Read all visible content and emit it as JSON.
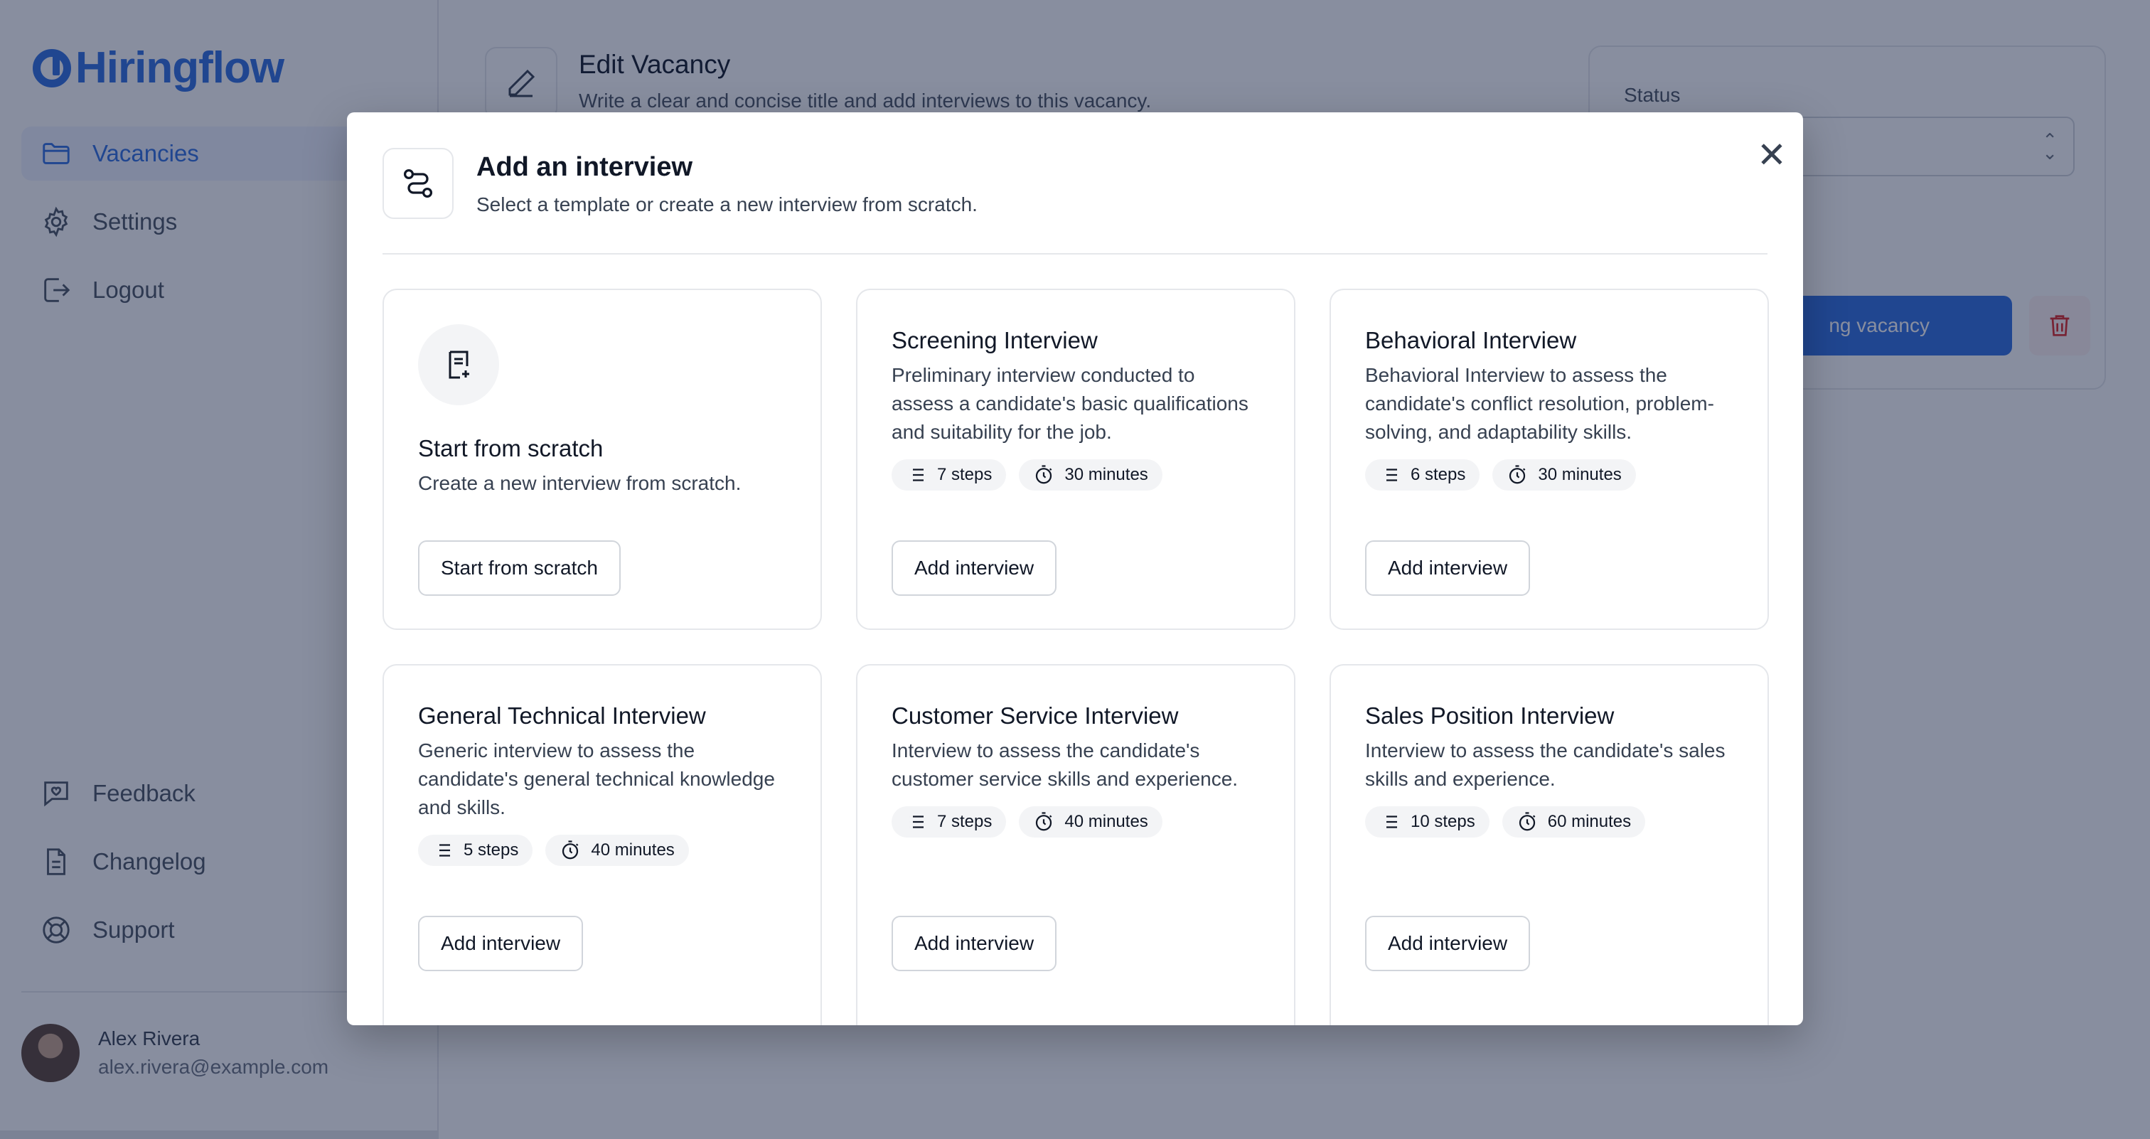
{
  "app": {
    "name": "Hiringflow"
  },
  "sidebar": {
    "items": [
      {
        "label": "Vacancies",
        "icon": "folder-icon",
        "active": true
      },
      {
        "label": "Settings",
        "icon": "gear-icon"
      },
      {
        "label": "Logout",
        "icon": "logout-icon"
      }
    ],
    "bottom_items": [
      {
        "label": "Feedback",
        "icon": "feedback-icon"
      },
      {
        "label": "Changelog",
        "icon": "document-icon"
      },
      {
        "label": "Support",
        "icon": "lifebuoy-icon"
      }
    ],
    "user": {
      "name": "Alex Rivera",
      "email": "alex.rivera@example.com"
    }
  },
  "page": {
    "title": "Edit Vacancy",
    "subtitle": "Write a clear and concise title and add interviews to this vacancy.",
    "status_label": "Status",
    "primary_button_partial": "ng vacancy"
  },
  "modal": {
    "title": "Add an interview",
    "subtitle": "Select a template or create a new interview from scratch.",
    "close_symbol": "✕",
    "scratch_card": {
      "title": "Start from scratch",
      "description": "Create a new interview from scratch.",
      "button": "Start from scratch"
    },
    "templates": [
      {
        "title": "Screening Interview",
        "description": "Preliminary interview conducted to assess a candidate's basic qualifications and suitability for the job.",
        "steps": "7 steps",
        "duration": "30 minutes",
        "button": "Add interview"
      },
      {
        "title": "Behavioral Interview",
        "description": "Behavioral Interview to assess the candidate's conflict resolution, problem-solving, and adaptability skills.",
        "steps": "6 steps",
        "duration": "30 minutes",
        "button": "Add interview"
      },
      {
        "title": "General Technical Interview",
        "description": "Generic interview to assess the candidate's general technical knowledge and skills.",
        "steps": "5 steps",
        "duration": "40 minutes",
        "button": "Add interview"
      },
      {
        "title": "Customer Service Interview",
        "description": "Interview to assess the candidate's customer service skills and experience.",
        "steps": "7 steps",
        "duration": "40 minutes",
        "button": "Add interview"
      },
      {
        "title": "Sales Position Interview",
        "description": "Interview to assess the candidate's sales skills and experience.",
        "steps": "10 steps",
        "duration": "60 minutes",
        "button": "Add interview"
      }
    ]
  },
  "colors": {
    "brand": "#2f6fe0",
    "overlay": "rgba(17,30,64,0.5)",
    "danger": "#dc2626"
  }
}
